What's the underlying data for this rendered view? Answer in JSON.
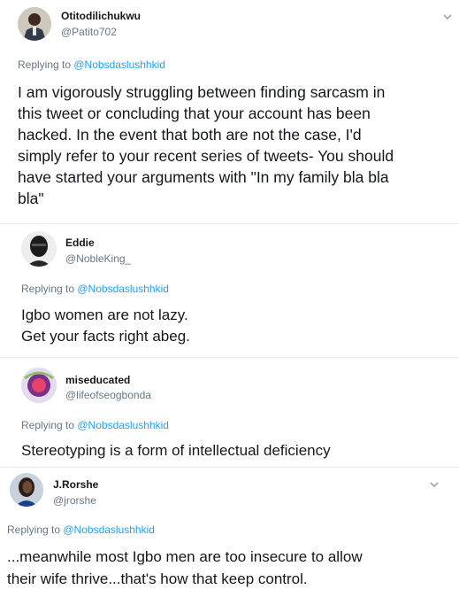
{
  "tweets": [
    {
      "name": "Otitodilichukwu",
      "handle": "@Patito702",
      "replying_prefix": "Replying to ",
      "replying_to": "@Nobsdaslushhkid",
      "lines": [
        "I am vigorously struggling between finding sarcasm in",
        "this tweet or concluding that your account has been",
        "hacked. In the event that both are not the case, I'd",
        "simply refer to your recent series of tweets- You should",
        "have started your arguments with \"In my family bla bla",
        "bla\""
      ]
    },
    {
      "name": "Eddie",
      "handle": "@NobleKing_",
      "replying_prefix": "Replying to ",
      "replying_to": "@Nobsdaslushhkid",
      "lines": [
        "Igbo women are not lazy.",
        "Get your facts right abeg."
      ]
    },
    {
      "name": "miseducated",
      "handle": "@lifeofseogbonda",
      "replying_prefix": "Replying to ",
      "replying_to": "@Nobsdaslushhkid",
      "lines": [
        "Stereotyping is a form of intellectual deficiency"
      ]
    },
    {
      "name": "J.Rorshe",
      "handle": "@jrorshe",
      "replying_prefix": "Replying to ",
      "replying_to": "@Nobsdaslushhkid",
      "lines": [
        "...meanwhile most Igbo men are too insecure to allow",
        "their wife thrive...that's how that keep control."
      ]
    }
  ],
  "icons": {
    "menu": "chevron-down-icon"
  },
  "colors": {
    "link": "#1da1f2",
    "secondary": "#657786",
    "text": "#14171a"
  }
}
